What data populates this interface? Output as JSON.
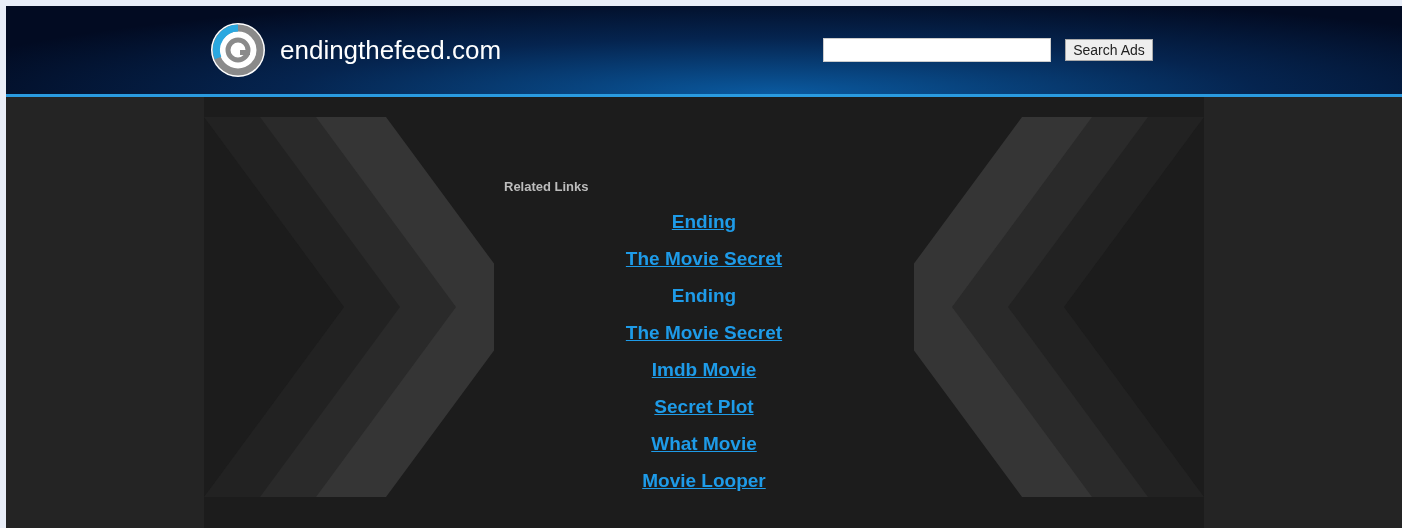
{
  "header": {
    "site_name": "endingthefeed.com",
    "search": {
      "button": "Search Ads"
    }
  },
  "related_links": {
    "heading": "Related Links",
    "links": [
      {
        "label": "Ending",
        "underlined": true
      },
      {
        "label": "The Movie Secret",
        "underlined": true
      },
      {
        "label": "Ending",
        "underlined": false
      },
      {
        "label": "The Movie Secret",
        "underlined": true
      },
      {
        "label": "Imdb Movie",
        "underlined": true
      },
      {
        "label": "Secret Plot",
        "underlined": true
      },
      {
        "label": "What Movie",
        "underlined": true
      },
      {
        "label": "Movie Looper",
        "underlined": true
      }
    ]
  }
}
